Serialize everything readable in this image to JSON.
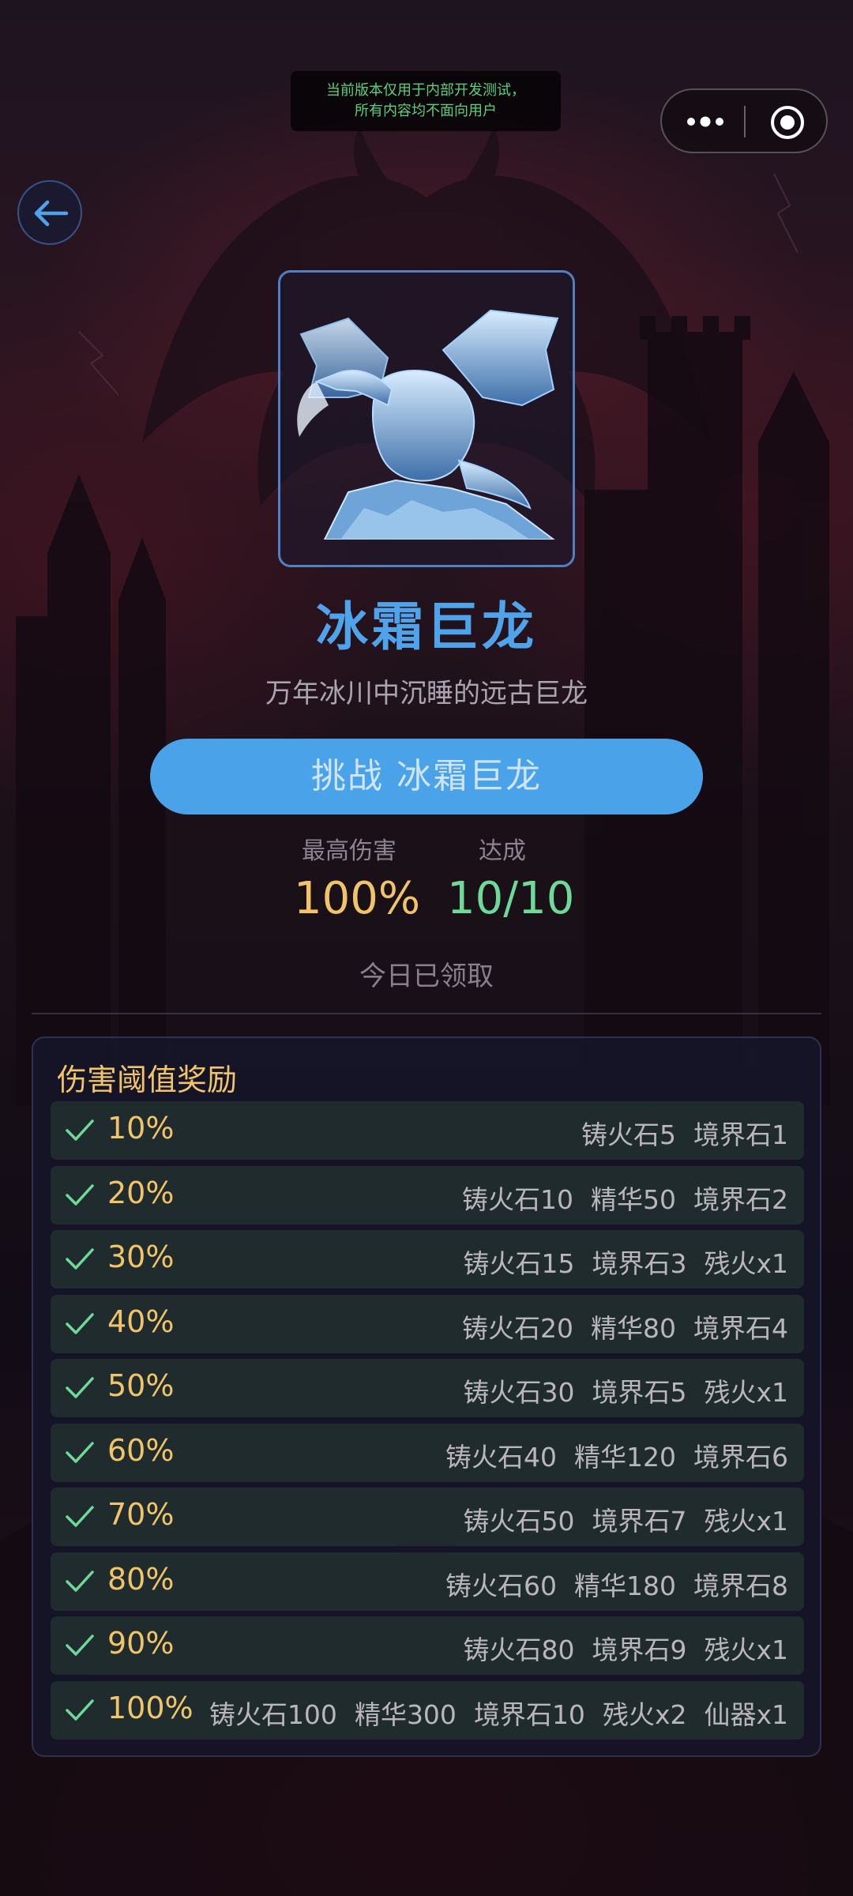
{
  "dev_notice": {
    "line1": "当前版本仅用于内部开发测试，",
    "line2": "所有内容均不面向用户"
  },
  "monster": {
    "name": "冰霜巨龙",
    "description": "万年冰川中沉睡的远古巨龙"
  },
  "challenge_button": "挑战 冰霜巨龙",
  "stats": {
    "max_damage_label": "最高伤害",
    "max_damage_value": "100%",
    "reached_label": "达成",
    "reached_value": "10/10"
  },
  "claimed_text": "今日已领取",
  "rewards": {
    "title": "伤害阈值奖励",
    "rows": [
      {
        "threshold": "10%",
        "items": [
          "铸火石5",
          "境界石1"
        ]
      },
      {
        "threshold": "20%",
        "items": [
          "铸火石10",
          "精华50",
          "境界石2"
        ]
      },
      {
        "threshold": "30%",
        "items": [
          "铸火石15",
          "境界石3",
          "残火x1"
        ]
      },
      {
        "threshold": "40%",
        "items": [
          "铸火石20",
          "精华80",
          "境界石4"
        ]
      },
      {
        "threshold": "50%",
        "items": [
          "铸火石30",
          "境界石5",
          "残火x1"
        ]
      },
      {
        "threshold": "60%",
        "items": [
          "铸火石40",
          "精华120",
          "境界石6"
        ]
      },
      {
        "threshold": "70%",
        "items": [
          "铸火石50",
          "境界石7",
          "残火x1"
        ]
      },
      {
        "threshold": "80%",
        "items": [
          "铸火石60",
          "精华180",
          "境界石8"
        ]
      },
      {
        "threshold": "90%",
        "items": [
          "铸火石80",
          "境界石9",
          "残火x1"
        ]
      },
      {
        "threshold": "100%",
        "items": [
          "铸火石100",
          "精华300",
          "境界石10",
          "残火x2",
          "仙器x1"
        ]
      }
    ]
  },
  "colors": {
    "accent_blue": "#4aa3e8",
    "gold": "#f1c46a",
    "green": "#6fd99a"
  },
  "icons": {
    "back": "back-arrow-icon",
    "more": "more-icon",
    "close": "target-icon",
    "check": "check-icon"
  }
}
